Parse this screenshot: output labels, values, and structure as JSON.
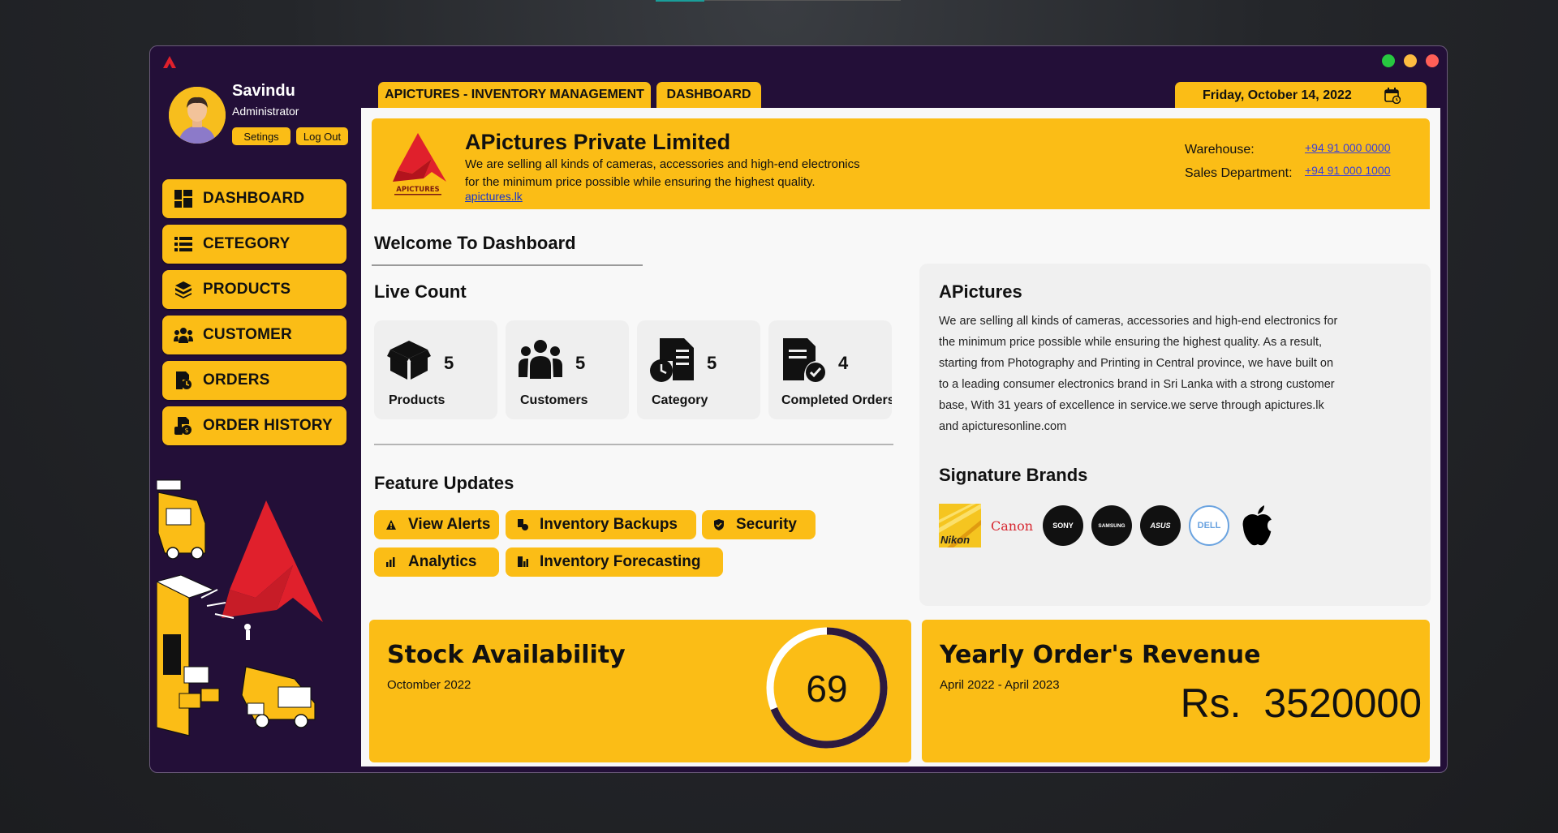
{
  "window": {
    "controls": [
      {
        "name": "maximize",
        "color": "#27c840"
      },
      {
        "name": "minimize",
        "color": "#fdbc40"
      },
      {
        "name": "close",
        "color": "#ff5f57"
      }
    ]
  },
  "profile": {
    "name": "Savindu",
    "role": "Administrator",
    "settings_label": "Setings",
    "logout_label": "Log Out"
  },
  "sidebar": {
    "items": [
      {
        "label": "DASHBOARD",
        "icon": "dashboard-icon"
      },
      {
        "label": "CETEGORY",
        "icon": "list-icon"
      },
      {
        "label": "PRODUCTS",
        "icon": "boxes-icon"
      },
      {
        "label": "CUSTOMER",
        "icon": "users-icon"
      },
      {
        "label": "ORDERS",
        "icon": "file-clock-icon"
      },
      {
        "label": "ORDER HISTORY",
        "icon": "file-money-icon"
      }
    ]
  },
  "tabs": [
    {
      "label": "APICTURES - INVENTORY MANAGEMENT"
    },
    {
      "label": "DASHBOARD"
    }
  ],
  "date": {
    "label": "Friday, October 14, 2022",
    "icon": "calendar-icon"
  },
  "banner": {
    "logo_text": "APICTURES",
    "title": "APictures Private Limited",
    "desc_line1": "We are selling all kinds of cameras, accessories and high-end electronics",
    "desc_line2": "for the minimum price possible while ensuring the highest quality.",
    "link": "apictures.lk",
    "warehouse_label": "Warehouse:",
    "warehouse_phone": "+94 91 000 0000",
    "sales_label": "Sales Department:",
    "sales_phone": "+94 91 000 1000"
  },
  "dashboard": {
    "welcome": "Welcome To Dashboard",
    "live_count_title": "Live Count",
    "stats": [
      {
        "label": "Products",
        "value": "5",
        "icon": "box-icon"
      },
      {
        "label": "Customers",
        "value": "5",
        "icon": "users-icon"
      },
      {
        "label": "Category",
        "value": "5",
        "icon": "file-clock-icon"
      },
      {
        "label": "Completed Orders",
        "value": "4",
        "icon": "file-check-icon"
      }
    ],
    "feature_title": "Feature Updates",
    "features": [
      {
        "label": "View Alerts",
        "icon": "alert-icon"
      },
      {
        "label": "Inventory Backups",
        "icon": "backup-icon"
      },
      {
        "label": "Security",
        "icon": "shield-icon"
      },
      {
        "label": "Analytics",
        "icon": "bar-chart-icon"
      },
      {
        "label": "Inventory Forecasting",
        "icon": "forecast-icon"
      }
    ]
  },
  "about": {
    "title": "APictures",
    "text": "We are selling all kinds of cameras, accessories and high-end electronics for the minimum price possible while ensuring the highest quality. As a result, starting from Photography and Printing in Central province, we have built on to a leading consumer electronics brand in Sri Lanka with a strong customer base, With 31 years of excellence in service.we serve through apictures.lk and apicturesonline.com",
    "brands_title": "Signature Brands",
    "brands": [
      {
        "name": "Nikon",
        "icon": "nikon-logo"
      },
      {
        "name": "Canon",
        "icon": "canon-logo"
      },
      {
        "name": "SONY",
        "icon": "sony-logo"
      },
      {
        "name": "SAMSUNG",
        "icon": "samsung-logo"
      },
      {
        "name": "ASUS",
        "icon": "asus-logo"
      },
      {
        "name": "DELL",
        "icon": "dell-logo"
      },
      {
        "name": "Apple",
        "icon": "apple-logo"
      }
    ]
  },
  "stock": {
    "title": "Stock Availability",
    "subtitle": "Octomber 2022",
    "value": "69",
    "percent": 69
  },
  "revenue": {
    "title": "Yearly Order's Revenue",
    "subtitle": "April 2022 - April 2023",
    "value": "Rs.  3520000"
  },
  "colors": {
    "accent": "#fbbd16",
    "sidebar": "#230f38",
    "logo_red": "#e0202c"
  }
}
